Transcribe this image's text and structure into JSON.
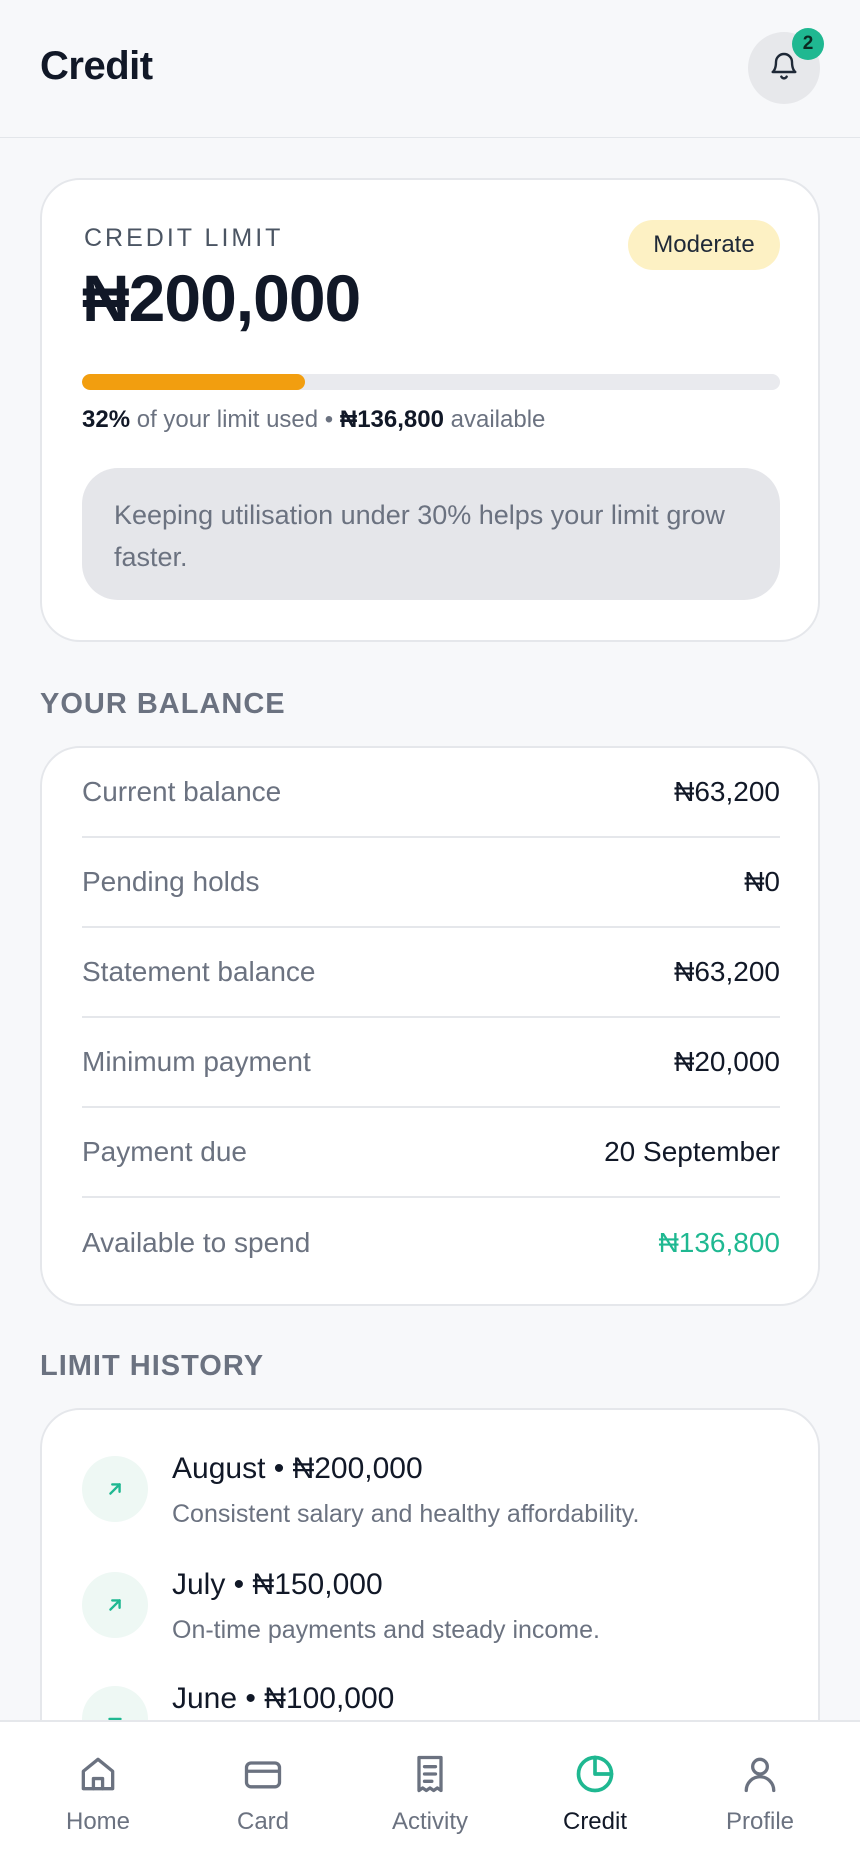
{
  "header": {
    "title": "Credit",
    "notification_count": "2"
  },
  "limit": {
    "label": "CREDIT LIMIT",
    "amount": "₦200,000",
    "status": "Moderate",
    "utilisation_fraction": 0.32,
    "used_percent": "32%",
    "used_text": "of your limit used •",
    "available_amount": "₦136,800",
    "available_text": "available",
    "tip": "Keeping utilisation under 30% helps your limit grow faster."
  },
  "balance": {
    "heading": "YOUR BALANCE",
    "rows": [
      {
        "label": "Current balance",
        "value": "₦63,200"
      },
      {
        "label": "Pending holds",
        "value": "₦0"
      },
      {
        "label": "Statement balance",
        "value": "₦63,200"
      },
      {
        "label": "Minimum payment",
        "value": "₦20,000"
      },
      {
        "label": "Payment due",
        "value": "20 September"
      },
      {
        "label": "Available to spend",
        "value": "₦136,800"
      }
    ]
  },
  "history": {
    "heading": "LIMIT HISTORY",
    "items": [
      {
        "title": "August • ₦200,000",
        "description": "Consistent salary and healthy affordability.",
        "icon": "arrow-up-right-icon"
      },
      {
        "title": "July • ₦150,000",
        "description": "On-time payments and steady income.",
        "icon": "arrow-up-right-icon"
      },
      {
        "title": "June • ₦100,000",
        "description": "",
        "icon": "dash-icon"
      }
    ]
  },
  "nav": {
    "items": [
      {
        "label": "Home",
        "icon": "home-icon"
      },
      {
        "label": "Card",
        "icon": "card-icon"
      },
      {
        "label": "Activity",
        "icon": "receipt-icon"
      },
      {
        "label": "Credit",
        "icon": "pie-chart-icon"
      },
      {
        "label": "Profile",
        "icon": "user-icon"
      }
    ],
    "active_index": 3
  },
  "colors": {
    "accent": "#1fb891",
    "progress": "#f29e0f",
    "badge_bg": "#fdf1c4"
  }
}
